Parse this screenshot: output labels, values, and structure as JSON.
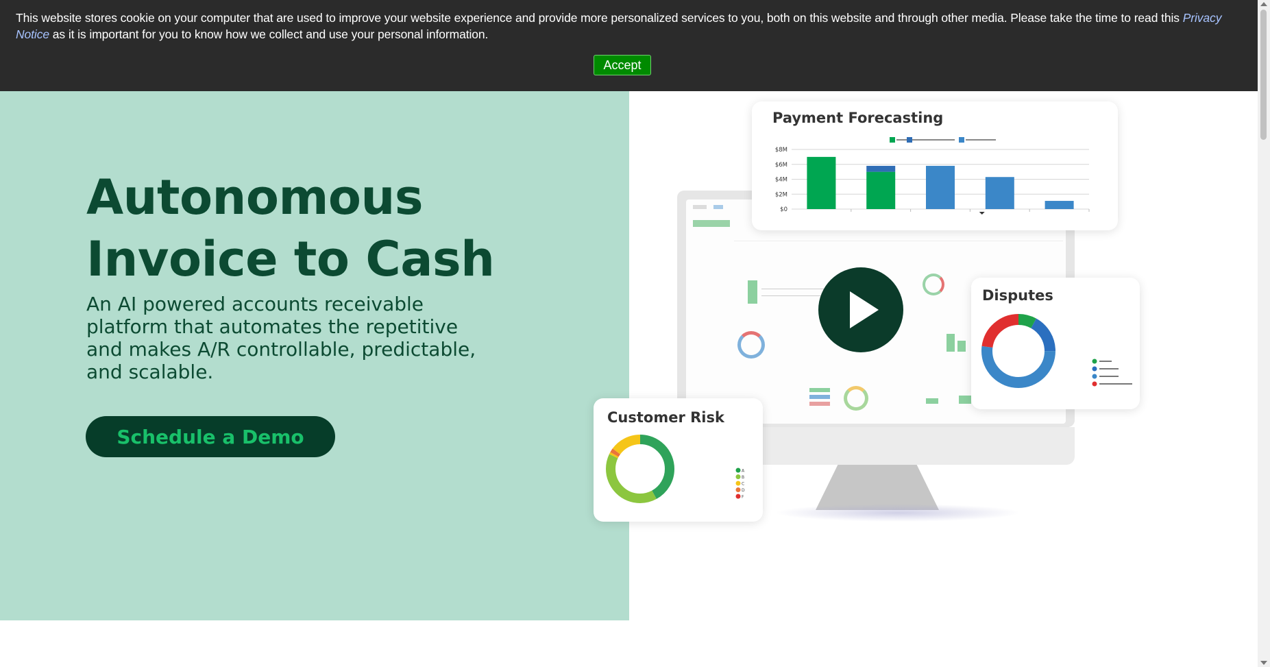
{
  "cookie_banner": {
    "text_before": "This website stores cookie on your computer that are used to improve your website experience and provide more personalized services to you, both on this website and through other media. Please take the time to read this ",
    "privacy_link": "Privacy Notice",
    "text_after": " as it is important for you to know how we collect and use your personal information.",
    "accept_label": "Accept"
  },
  "hero": {
    "title_line1": "Autonomous",
    "title_line2": "Invoice to Cash",
    "subtitle": "An AI powered accounts receivable platform that automates the repetitive and makes A/R controllable, predictable, and scalable.",
    "cta_label": "Schedule a Demo"
  },
  "colors": {
    "hero_bg": "#b3ddce",
    "brand_dark": "#0c4a32",
    "cta_text": "#19c06a",
    "green": "#00a651",
    "blue": "#3b87c8",
    "red": "#e02f2f",
    "yellow": "#f5c518"
  },
  "cards": {
    "forecast": {
      "title": "Payment Forecasting",
      "chart_data": {
        "type": "bar",
        "y_ticks": [
          "$8M",
          "$6M",
          "$4M",
          "$2M",
          "$0"
        ],
        "ylim": [
          0,
          8
        ],
        "series": [
          {
            "color": "#00a651",
            "values": [
              7.0,
              5.0,
              0,
              0,
              0
            ]
          },
          {
            "color": "#2f6db5",
            "values": [
              0,
              0.8,
              0,
              0,
              0
            ]
          },
          {
            "color": "#3b87c8",
            "values": [
              0,
              0,
              5.8,
              4.3,
              1.1
            ]
          }
        ]
      }
    },
    "disputes": {
      "title": "Disputes",
      "chart_data": {
        "type": "pie",
        "slices": [
          {
            "value": 8,
            "color": "#1fa24a"
          },
          {
            "value": 17,
            "color": "#2b6fbf"
          },
          {
            "value": 52,
            "color": "#3b87c8"
          },
          {
            "value": 23,
            "color": "#e02f2f"
          }
        ],
        "legend_colors": [
          "#1fa24a",
          "#2b6fbf",
          "#3b87c8",
          "#e02f2f"
        ]
      }
    },
    "risk": {
      "title": "Customer Risk",
      "legend": [
        "A",
        "B",
        "C",
        "D",
        "F"
      ],
      "chart_data": {
        "type": "pie",
        "slices": [
          {
            "value": 42,
            "color": "#2fa35a"
          },
          {
            "value": 40,
            "color": "#8cc63f"
          },
          {
            "value": 1,
            "color": "#f5c518"
          },
          {
            "value": 2,
            "color": "#e9753a"
          },
          {
            "value": 15,
            "color": "#f5c518"
          }
        ],
        "legend_colors": [
          "#1fa24a",
          "#8cc63f",
          "#f5c518",
          "#e9753a",
          "#e02f2f"
        ]
      }
    }
  },
  "icons": {
    "play": "play-icon"
  }
}
